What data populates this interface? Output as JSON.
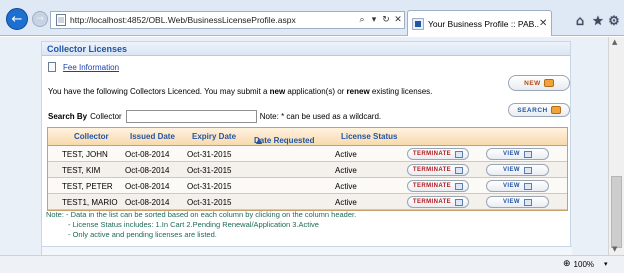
{
  "browser": {
    "url": "http://localhost:4852/OBL.Web/BusinessLicenseProfile.aspx",
    "tab_title": "Your Business Profile :: PAB...",
    "search_glyph": "⌕",
    "dropdown_glyph": "▾",
    "refresh_glyph": "↻",
    "close_glyph": "✕"
  },
  "panel": {
    "title": "Collector Licenses",
    "fee_link": "Fee Information",
    "intro_prefix": "You have the following Collectors Licenced. You may submit a ",
    "intro_new": "new",
    "intro_mid": " application(s) or ",
    "intro_renew": "renew",
    "intro_suffix": " existing licenses.",
    "new_button": "NEW",
    "search_button": "SEARCH",
    "search_label": "Search By",
    "search_field_label": "Collector",
    "search_value": "",
    "wildcard_note": "Note: * can be used as a wildcard."
  },
  "grid": {
    "columns": [
      "Collector",
      "Issued Date",
      "Expiry Date",
      "Date Requested",
      "License Status"
    ],
    "sort_glyph": "▲",
    "terminate_label": "TERMINATE",
    "view_label": "VIEW",
    "rows": [
      {
        "collector": "TEST, JOHN",
        "issued": "Oct-08-2014",
        "expiry": "Oct-31-2015",
        "requested": "",
        "status": "Active"
      },
      {
        "collector": "TEST, KIM",
        "issued": "Oct-08-2014",
        "expiry": "Oct-31-2015",
        "requested": "",
        "status": "Active"
      },
      {
        "collector": "TEST, PETER",
        "issued": "Oct-08-2014",
        "expiry": "Oct-31-2015",
        "requested": "",
        "status": "Active"
      },
      {
        "collector": "TEST1, MARIO",
        "issued": "Oct-08-2014",
        "expiry": "Oct-31-2015",
        "requested": "",
        "status": "Active"
      }
    ]
  },
  "notes": [
    "Note: - Data in the list can be sorted based on each column by clicking on the column header.",
    "- License Status includes: 1.In Cart   2.Pending Renewal/Application   3.Active",
    "- Only active and pending licenses are listed."
  ],
  "statusbar": {
    "zoom": "100%"
  },
  "colors": {
    "accent": "#2255a4",
    "grid_header": "#f8d9ad",
    "note_text": "#1d6a56",
    "terminate": "#b11a1a"
  }
}
